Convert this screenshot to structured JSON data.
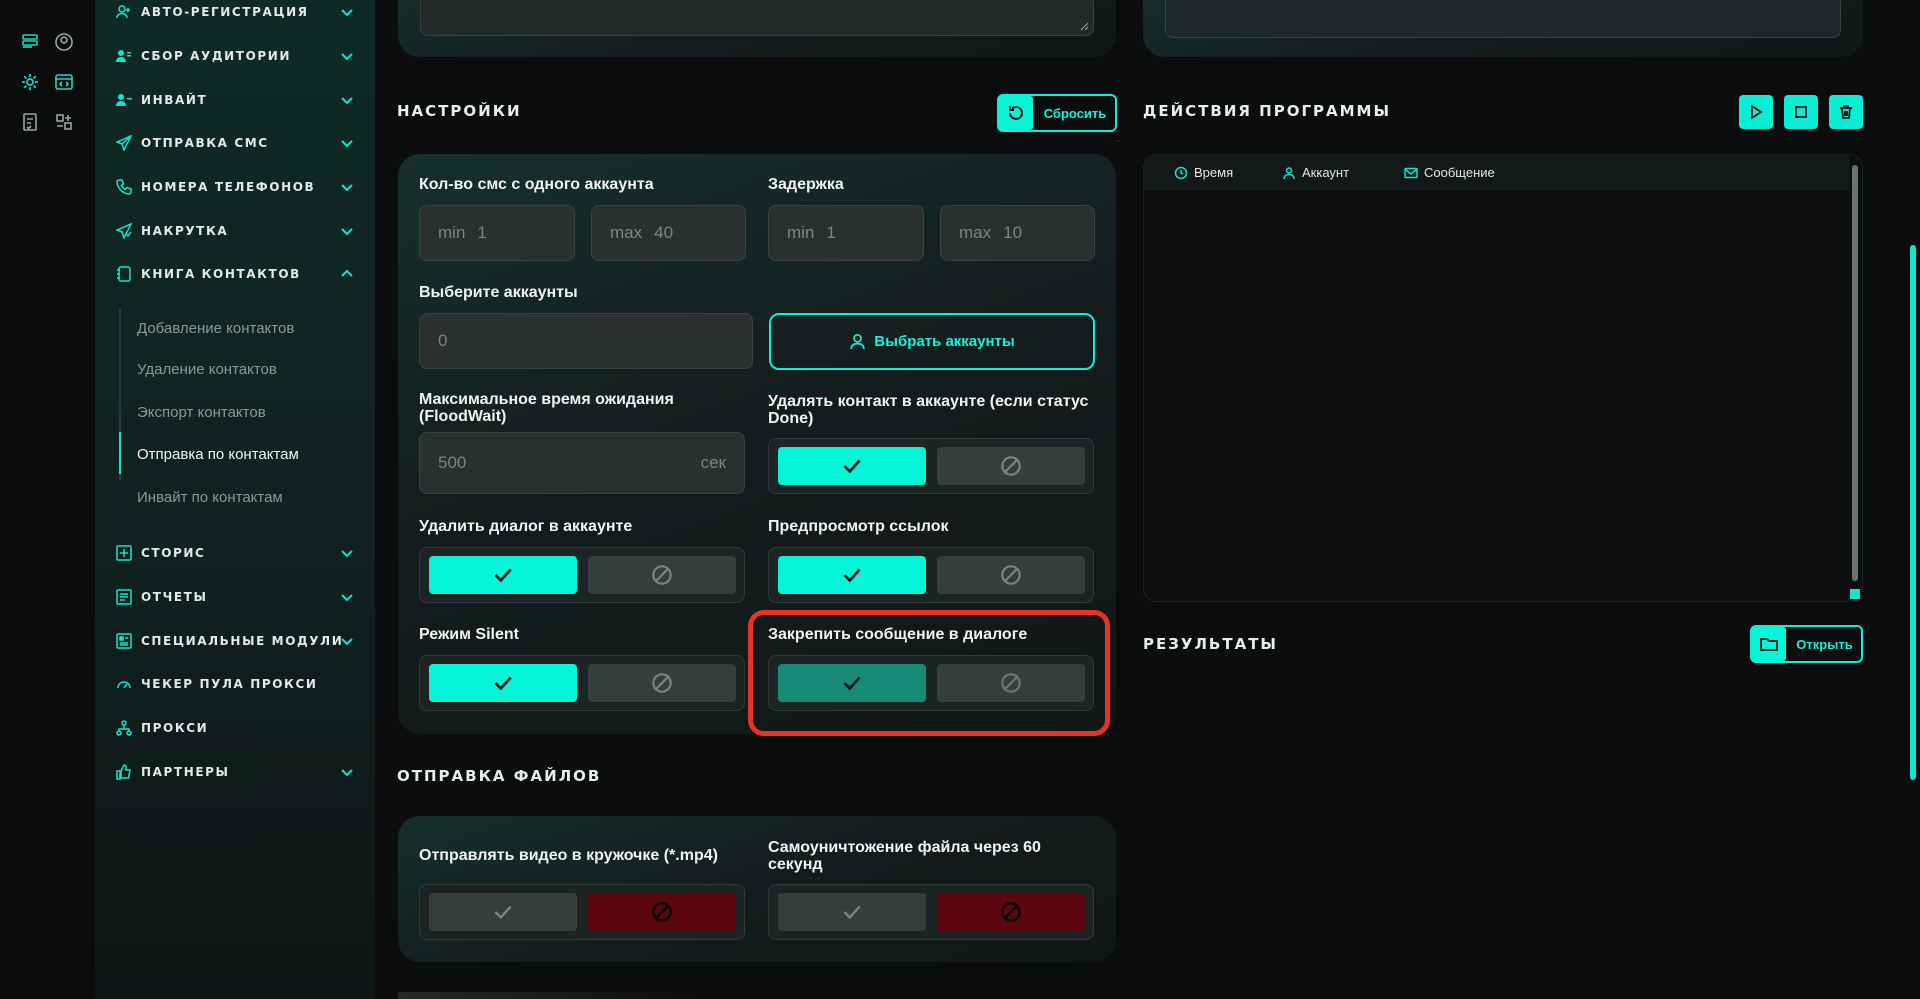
{
  "sidebar": {
    "items": [
      {
        "label": "АВТО-РЕГИСТРАЦИЯ",
        "icon": "user-add-icon",
        "chevron": "down"
      },
      {
        "label": "СБОР АУДИТОРИИ",
        "icon": "users-icon",
        "chevron": "down"
      },
      {
        "label": "ИНВАЙТ",
        "icon": "user-invite-icon",
        "chevron": "down"
      },
      {
        "label": "ОТПРАВКА СМС",
        "icon": "send-icon",
        "chevron": "down"
      },
      {
        "label": "НОМЕРА ТЕЛЕФОНОВ",
        "icon": "phone-icon",
        "chevron": "down"
      },
      {
        "label": "НАКРУТКА",
        "icon": "boost-icon",
        "chevron": "down"
      },
      {
        "label": "КНИГА КОНТАКТОВ",
        "icon": "contacts-book-icon",
        "chevron": "up"
      },
      {
        "label": "СТОРИС",
        "icon": "plus-square-icon",
        "chevron": "down"
      },
      {
        "label": "ОТЧЕТЫ",
        "icon": "report-icon",
        "chevron": "down"
      },
      {
        "label": "СПЕЦИАЛЬНЫЕ МОДУЛИ",
        "icon": "modules-icon",
        "chevron": "down"
      },
      {
        "label": "ЧЕКЕР ПУЛА ПРОКСИ",
        "icon": "gauge-icon",
        "chevron": ""
      },
      {
        "label": "ПРОКСИ",
        "icon": "network-icon",
        "chevron": ""
      },
      {
        "label": "ПАРТНЕРЫ",
        "icon": "thumb-up-icon",
        "chevron": "down"
      }
    ],
    "subitems": [
      "Добавление контактов",
      "Удаление контактов",
      "Экспорт контактов",
      "Отправка по контактам",
      "Инвайт по контактам"
    ],
    "active_subitem": "Отправка по контактам"
  },
  "settings": {
    "title": "НАСТРОЙКИ",
    "reset_label": "Сбросить",
    "sms_per_account_label": "Кол-во смс с одного аккаунта",
    "sms_min": {
      "prefix": "min",
      "value": "1"
    },
    "sms_max": {
      "prefix": "max",
      "value": "40"
    },
    "delay_label": "Задержка",
    "delay_min": {
      "prefix": "min",
      "value": "1"
    },
    "delay_max": {
      "prefix": "max",
      "value": "10"
    },
    "accounts_label": "Выберите аккаунты",
    "accounts_value": "0",
    "select_accounts_label": "Выбрать аккаунты",
    "floodwait_label": "Максимальное время ожидания (FloodWait)",
    "floodwait_value": "500",
    "floodwait_unit": "сек",
    "delete_contact_label": "Удалять контакт в аккаунте (если статус Done)",
    "delete_dialog_label": "Удалить диалог в аккаунте",
    "link_preview_label": "Предпросмотр ссылок",
    "silent_label": "Режим Silent",
    "pin_message_label": "Закрепить сообщение в диалоге",
    "delete_contact_enabled": true,
    "delete_dialog_enabled": true,
    "link_preview_enabled": true,
    "silent_enabled": true,
    "pin_message_enabled": true
  },
  "files": {
    "title": "ОТПРАВКА ФАЙЛОВ",
    "video_circle_label": "Отправлять видео в кружочке (*.mp4)",
    "self_destruct_label": "Самоуничтожение файла через 60 секунд",
    "video_circle_enabled": false,
    "self_destruct_enabled": false
  },
  "actions": {
    "title": "ДЕЙСТВИЯ ПРОГРАММЫ",
    "columns": [
      "Время",
      "Аккаунт",
      "Сообщение"
    ]
  },
  "results": {
    "title": "РЕЗУЛЬТАТЫ",
    "open_label": "Открыть"
  },
  "colors": {
    "accent": "#05f5d8",
    "highlight": "#e5332a",
    "danger": "#5c0610"
  }
}
